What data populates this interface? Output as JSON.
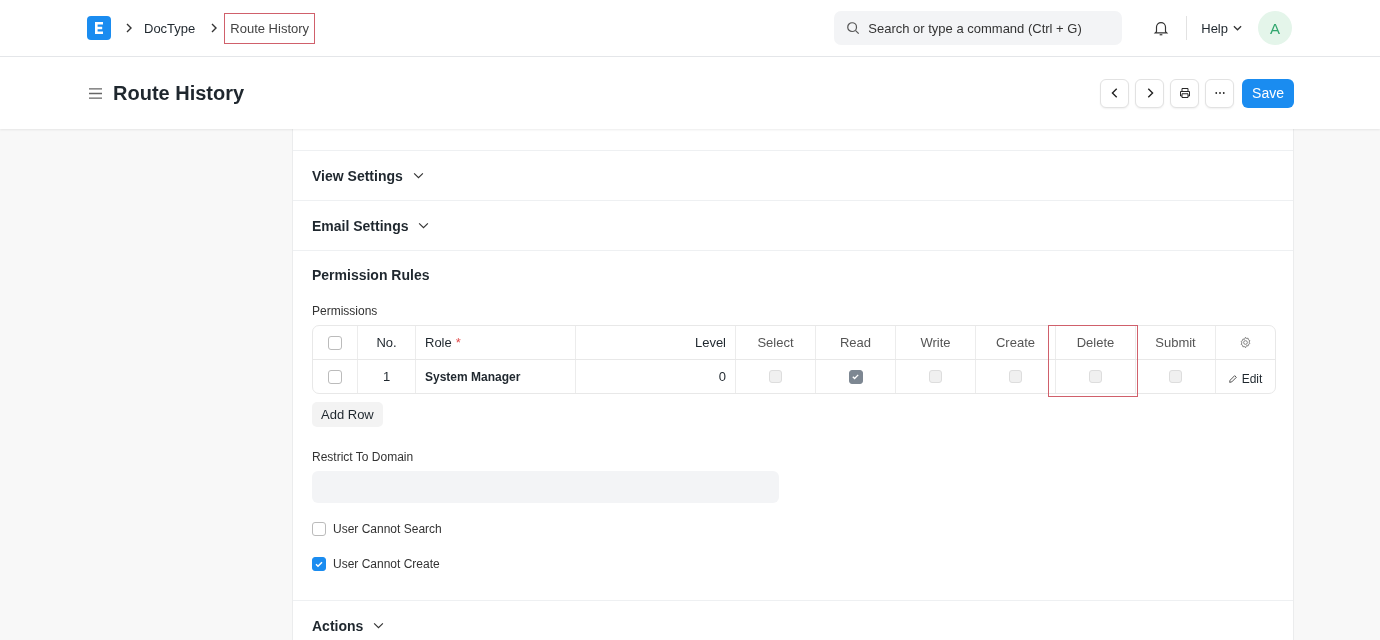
{
  "topbar": {
    "breadcrumbs": [
      {
        "label": "DocType",
        "highlighted": false
      },
      {
        "label": "Route History",
        "highlighted": true
      }
    ],
    "search": {
      "placeholder": "Search or type a command (Ctrl + G)"
    },
    "help": "Help",
    "avatar": "A"
  },
  "page_header": {
    "title": "Route History",
    "save": "Save"
  },
  "collapsed_sections": [
    {
      "title": "View Settings",
      "expanded": false
    },
    {
      "title": "Email Settings",
      "expanded": false
    }
  ],
  "permission_rules": {
    "title": "Permission Rules",
    "table_label": "Permissions",
    "columns": [
      {
        "kind": "select",
        "all_selected": false
      },
      {
        "kind": "index",
        "label": "No."
      },
      {
        "kind": "role",
        "label": "Role",
        "required_mark": "*"
      },
      {
        "kind": "number",
        "label": "Level"
      },
      {
        "kind": "check",
        "label": "Select"
      },
      {
        "kind": "check",
        "label": "Read"
      },
      {
        "kind": "check",
        "label": "Write"
      },
      {
        "kind": "check",
        "label": "Create"
      },
      {
        "kind": "check",
        "label": "Delete",
        "highlighted": true
      },
      {
        "kind": "check",
        "label": "Submit"
      },
      {
        "kind": "settings"
      }
    ],
    "rows": [
      {
        "selected": false,
        "no": "1",
        "role": "System Manager",
        "level": "0",
        "checks": [
          false,
          true,
          false,
          false,
          false,
          false
        ],
        "edit": "Edit"
      }
    ],
    "add_row": "Add Row",
    "restrict_label": "Restrict To Domain",
    "options": [
      {
        "label": "User Cannot Search",
        "checked": false
      },
      {
        "label": "User Cannot Create",
        "checked": true
      }
    ]
  },
  "bottom_section": {
    "title": "Actions",
    "expanded": false
  }
}
